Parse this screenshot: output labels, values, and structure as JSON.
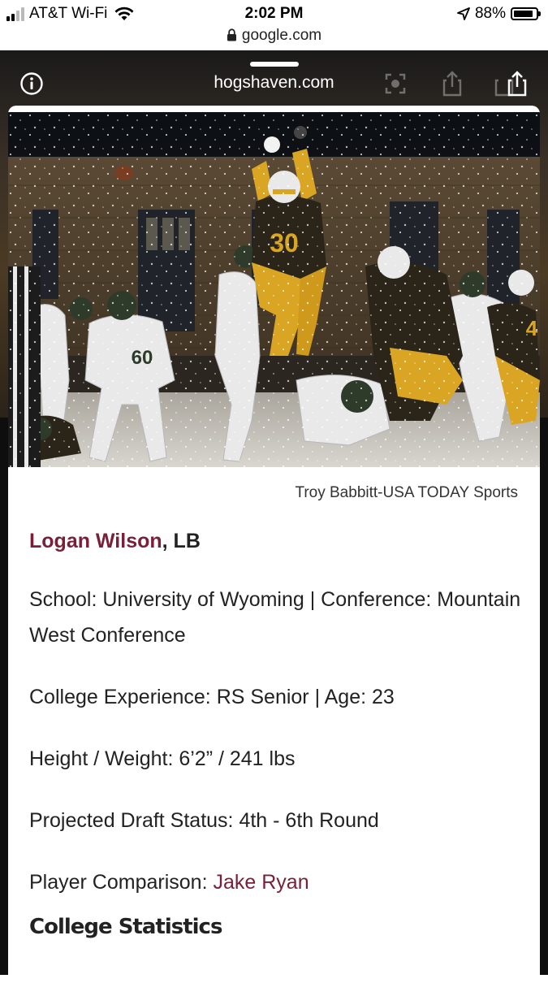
{
  "status_bar": {
    "carrier": "AT&T Wi-Fi",
    "time": "2:02 PM",
    "url": "google.com",
    "battery": "88%",
    "battery_level": 0.88
  },
  "viewer": {
    "host": "hogshaven.com"
  },
  "photo": {
    "credit": "Troy Babbitt-USA TODAY Sports",
    "jersey_numbers": [
      "30",
      "60",
      "4"
    ]
  },
  "article": {
    "player_name": "Logan Wilson",
    "player_position": ", LB",
    "school_line": "School: University of Wyoming | Conference: Mountain West Conference",
    "experience_line": "College Experience: RS Senior | Age: 23",
    "size_line": "Height / Weight: 6’2” / 241 lbs",
    "draft_line": "Projected Draft Status: 4th - 6th Round",
    "comparison_label": "Player Comparison: ",
    "comparison_name": "Jake Ryan",
    "section_heading": "College Statistics"
  },
  "colors": {
    "link": "#7a1f38",
    "text": "#222222"
  },
  "icons": [
    "signal-icon",
    "wifi-icon",
    "lock-icon",
    "location-arrow-icon",
    "battery-icon",
    "info-icon",
    "screenshot-icon",
    "share-icon"
  ]
}
